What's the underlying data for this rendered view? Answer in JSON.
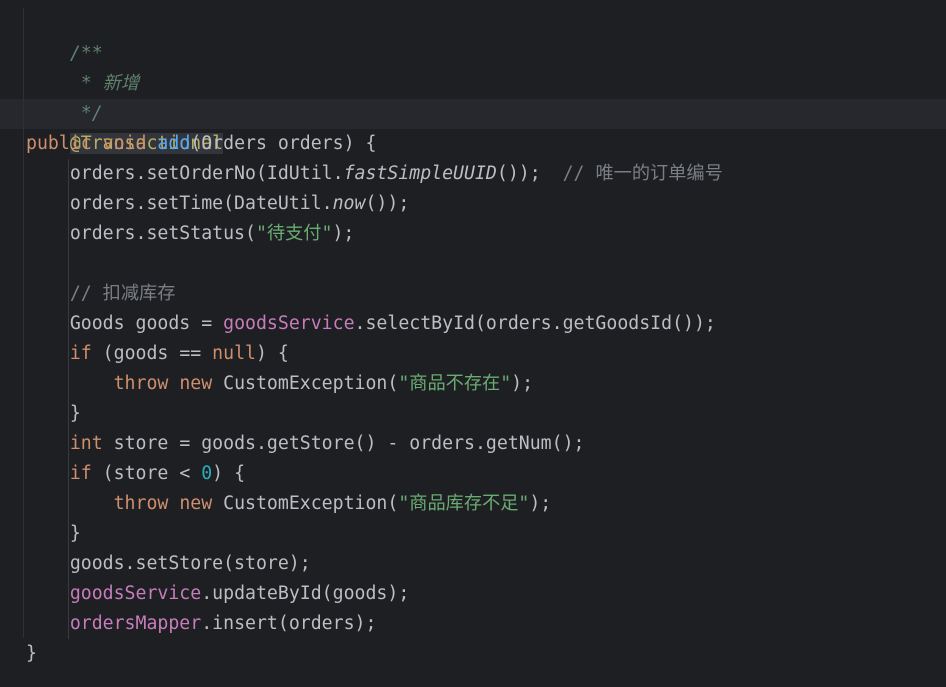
{
  "code": {
    "doc_open": "/**",
    "doc_line": " * 新增",
    "doc_close": " */",
    "annotation": "@Transactional",
    "signature": {
      "kw_public": "public",
      "kw_void": "void",
      "method_name": "add",
      "params": "(Orders orders) {"
    },
    "l1": {
      "prefix": "orders.setOrderNo(IdUtil.",
      "static_call": "fastSimpleUUID",
      "suffix": "());",
      "comment": "// 唯一的订单编号"
    },
    "l2": {
      "prefix": "orders.setTime(DateUtil.",
      "static_call": "now",
      "suffix": "());"
    },
    "l3": {
      "prefix": "orders.setStatus(",
      "str": "\"待支付\"",
      "suffix": ");"
    },
    "comment_stock": "// 扣减库存",
    "l4": {
      "prefix": "Goods goods = ",
      "field": "goodsService",
      "suffix": ".selectById(orders.getGoodsId());"
    },
    "l5": {
      "kw_if": "if",
      "mid": " (goods == ",
      "kw_null": "null",
      "suffix": ") {"
    },
    "l6": {
      "kw_throw": "throw",
      "kw_new": "new",
      "mid": " CustomException(",
      "str": "\"商品不存在\"",
      "suffix": ");"
    },
    "close_brace": "}",
    "l7": {
      "kw_int": "int",
      "rest": " store = goods.getStore() - orders.getNum();"
    },
    "l8": {
      "kw_if": "if",
      "mid": " (store < ",
      "num": "0",
      "suffix": ") {"
    },
    "l9": {
      "kw_throw": "throw",
      "kw_new": "new",
      "mid": " CustomException(",
      "str": "\"商品库存不足\"",
      "suffix": ");"
    },
    "l10": "goods.setStore(store);",
    "l11": {
      "field": "goodsService",
      "suffix": ".updateById(goods);"
    },
    "l12": {
      "field": "ordersMapper",
      "suffix": ".insert(orders);"
    },
    "method_close": "}"
  }
}
